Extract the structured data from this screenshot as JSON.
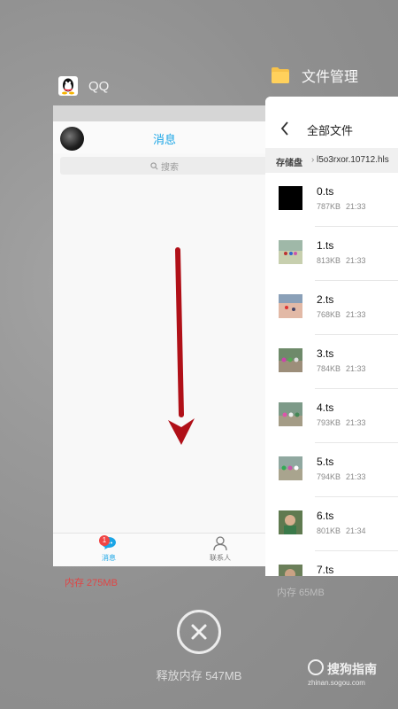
{
  "qq": {
    "app_name": "QQ",
    "nav_title": "消息",
    "search_placeholder": "搜索",
    "tabs": [
      {
        "label": "消息",
        "badge": "1"
      },
      {
        "label": "联系人"
      }
    ],
    "memory": "内存 275MB"
  },
  "file_manager": {
    "app_name": "文件管理",
    "nav_title": "全部文件",
    "path_root": "存储盘",
    "path_sep": "›",
    "path_dir": "l5o3rxor.10712.hls",
    "files": [
      {
        "name": "0.ts",
        "size": "787KB",
        "time": "21:33",
        "thumb": "black"
      },
      {
        "name": "1.ts",
        "size": "813KB",
        "time": "21:33",
        "thumb": "landscape"
      },
      {
        "name": "2.ts",
        "size": "768KB",
        "time": "21:33",
        "thumb": "beach"
      },
      {
        "name": "3.ts",
        "size": "784KB",
        "time": "21:33",
        "thumb": "group"
      },
      {
        "name": "4.ts",
        "size": "793KB",
        "time": "21:33",
        "thumb": "group"
      },
      {
        "name": "5.ts",
        "size": "794KB",
        "time": "21:33",
        "thumb": "group"
      },
      {
        "name": "6.ts",
        "size": "801KB",
        "time": "21:34",
        "thumb": "portrait"
      },
      {
        "name": "7.ts",
        "size": "",
        "time": "",
        "thumb": "portrait"
      }
    ],
    "memory": "内存 65MB"
  },
  "clear": {
    "label": "释放内存 547MB"
  },
  "watermark": {
    "text": "搜狗指南",
    "url": "zhinan.sogou.com"
  },
  "colors": {
    "qq_blue": "#1aa5e6",
    "memory_red": "#e04545",
    "folder_yellow": "#f7c24a",
    "arrow_red": "#b01018"
  }
}
